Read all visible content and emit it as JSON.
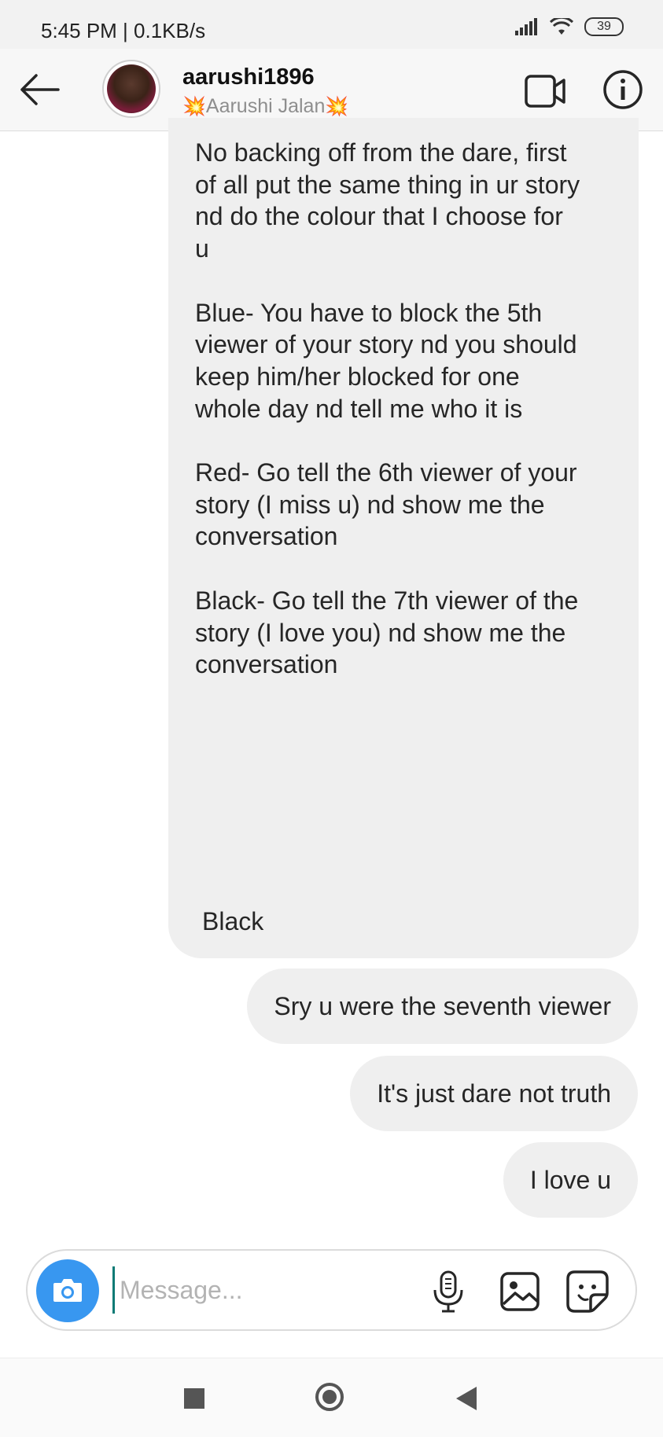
{
  "status_bar": {
    "time": "5:45 PM | 0.1KB/s",
    "battery": "39"
  },
  "header": {
    "username": "aarushi1896",
    "full_name": "Aarushi Jalan",
    "name_emoji": "💥"
  },
  "conversation": {
    "shared_message": {
      "paragraphs": [
        "No backing off from the dare, first\nof all put the same thing in ur story\nnd do the colour that I choose for\nu",
        "Blue- You have to block the 5th\nviewer of your story nd you should\nkeep him/her blocked for one\nwhole day nd tell me who it is",
        "Red- Go tell the 6th viewer of your\nstory (I miss u) nd show me the\nconversation",
        "Black- Go tell the 7th viewer of the\nstory (I love you) nd show me the\nconversation"
      ],
      "reply": "Black"
    },
    "messages": [
      {
        "text": "Sry u were the seventh viewer"
      },
      {
        "text": "It's just dare not truth"
      },
      {
        "text": "I love u"
      }
    ]
  },
  "composer": {
    "placeholder": "Message..."
  },
  "colors": {
    "bubble": "#efefef",
    "camera": "#3897f0"
  },
  "icons": [
    "back-arrow-icon",
    "video-call-icon",
    "info-icon",
    "camera-icon",
    "microphone-icon",
    "gallery-icon",
    "sticker-icon"
  ]
}
